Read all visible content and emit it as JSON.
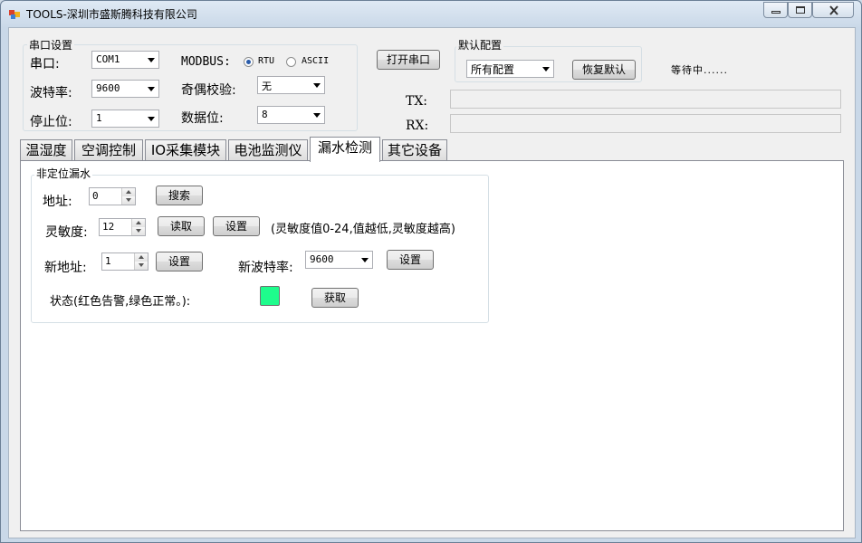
{
  "window": {
    "title": "TOOLS-深圳市盛斯腾科技有限公司",
    "buttons": [
      "minimize-icon",
      "maximize-icon",
      "close-icon"
    ]
  },
  "serial": {
    "group_title": "串口设置",
    "port_label": "串口:",
    "port_value": "COM1",
    "baud_label": "波特率:",
    "baud_value": "9600",
    "stop_label": "停止位:",
    "stop_value": "1",
    "modbus_label": "MODBUS:",
    "rtu_label": "RTU",
    "ascii_label": "ASCII",
    "modbus_selected": "RTU",
    "parity_label": "奇偶校验:",
    "parity_value": "无",
    "databits_label": "数据位:",
    "databits_value": "8",
    "open_button": "打开串口"
  },
  "defaults": {
    "group_title": "默认配置",
    "combo_value": "所有配置",
    "restore_button": "恢复默认",
    "status_text": "等待中......"
  },
  "io": {
    "tx_label": "TX:",
    "tx_value": "",
    "rx_label": "RX:",
    "rx_value": ""
  },
  "tabs": [
    {
      "label": "温湿度"
    },
    {
      "label": "空调控制"
    },
    {
      "label": "IO采集模块"
    },
    {
      "label": "电池监测仪"
    },
    {
      "label": "漏水检测"
    },
    {
      "label": "其它设备"
    }
  ],
  "active_tab": "漏水检测",
  "leak": {
    "group_title": "非定位漏水",
    "address_label": "地址:",
    "address_value": "0",
    "search_button": "搜索",
    "sensitivity_label": "灵敏度:",
    "sensitivity_value": "12",
    "read_button": "读取",
    "set_sensitivity_button": "设置",
    "sensitivity_hint": "(灵敏度值0-24,值越低,灵敏度越高)",
    "new_address_label": "新地址:",
    "new_address_value": "1",
    "set_address_button": "设置",
    "new_baud_label": "新波特率:",
    "new_baud_value": "9600",
    "set_baud_button": "设置",
    "status_label": "状态(红色告警,绿色正常。):",
    "status_color": "#1efc8c",
    "get_button": "获取"
  }
}
